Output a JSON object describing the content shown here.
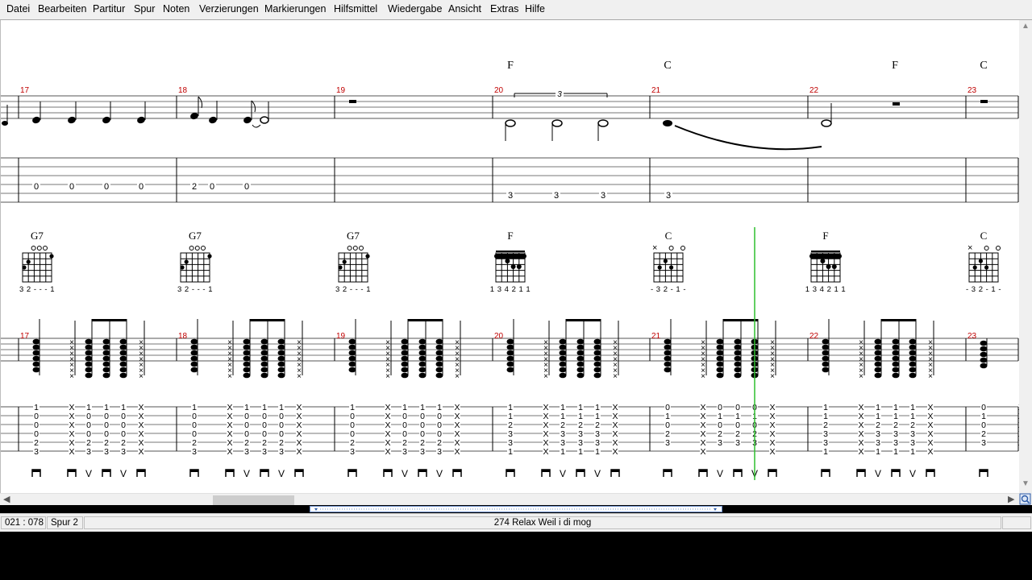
{
  "menu": [
    "Datei",
    "Bearbeiten",
    "Partitur",
    "Spur",
    "Noten",
    "Verzierungen",
    "Markierungen",
    "Hilfsmittel",
    "Wiedergabe",
    "Ansicht",
    "Extras",
    "Hilfe"
  ],
  "upper_system": {
    "measure_numbers": [
      "17",
      "18",
      "19",
      "20",
      "21",
      "22",
      "23"
    ],
    "chords": [
      {
        "name": "F",
        "measure": 20
      },
      {
        "name": "C",
        "measure": 21
      },
      {
        "name": "F",
        "measure": 22
      },
      {
        "name": "C",
        "measure": 23
      }
    ],
    "tuplet_label": "3",
    "tab_numbers_m17": [
      "0",
      "0",
      "0",
      "0"
    ],
    "tab_numbers_m18": [
      "2",
      "0",
      "0"
    ],
    "tab_numbers_m20": [
      "3",
      "3",
      "3"
    ],
    "tab_numbers_m21": [
      "3"
    ]
  },
  "lower_system": {
    "measure_numbers": [
      "17",
      "18",
      "19",
      "20",
      "21",
      "22",
      "23"
    ],
    "chord_diagrams": [
      {
        "name": "G7",
        "fingering": "32---1",
        "top": [
          "o",
          "o",
          "o"
        ]
      },
      {
        "name": "G7",
        "fingering": "32---1",
        "top": [
          "o",
          "o",
          "o"
        ]
      },
      {
        "name": "G7",
        "fingering": "32---1",
        "top": [
          "o",
          "o",
          "o"
        ]
      },
      {
        "name": "F",
        "fingering": "134211",
        "top": []
      },
      {
        "name": "C",
        "fingering": "-32-1-",
        "top": [
          "x",
          "o",
          "o"
        ]
      },
      {
        "name": "F",
        "fingering": "134211",
        "top": []
      },
      {
        "name": "C",
        "fingering": "-32-1-",
        "top": [
          "x",
          "o",
          "o"
        ]
      }
    ],
    "tab_columns": {
      "G7": [
        "1",
        "0",
        "0",
        "0",
        "2",
        "3"
      ],
      "F": [
        "1",
        "1",
        "2",
        "3",
        "3",
        "1"
      ],
      "C": [
        "0",
        "1",
        "0",
        "2",
        "3"
      ],
      "X": [
        "X",
        "X",
        "X",
        "X",
        "X",
        "X"
      ]
    },
    "strokes": {
      "down": "⊓",
      "up": "V"
    }
  },
  "status": {
    "position": "021 : 078",
    "track": "Spur 2",
    "song": "274   Relax  Weil i di mog"
  },
  "colors": {
    "measure_number": "#c00000",
    "playhead": "#2fbf2f"
  }
}
